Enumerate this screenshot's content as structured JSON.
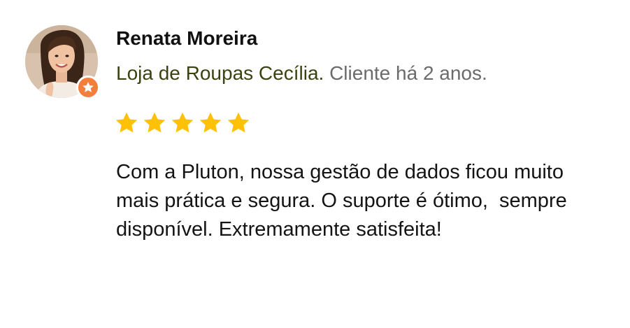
{
  "review": {
    "author_name": "Renata Moreira",
    "company": "Loja de Roupas Cecília",
    "separator": ". ",
    "customer_since": "Cliente há 2 anos.",
    "rating": 5,
    "rating_max": 5,
    "text": "Com a Pluton, nossa gestão de dados ficou muito mais prática e segura. O suporte é ótimo,  sempre disponível. Extremamente satisfeita!"
  },
  "icons": {
    "avatar": "avatar-photo",
    "badge": "star-badge-icon",
    "rating_star": "star-icon"
  },
  "colors": {
    "star": "#FFC107",
    "badge": "#F47E3C",
    "company": "#3A4310",
    "muted": "#6B6B6B",
    "text": "#141414"
  }
}
